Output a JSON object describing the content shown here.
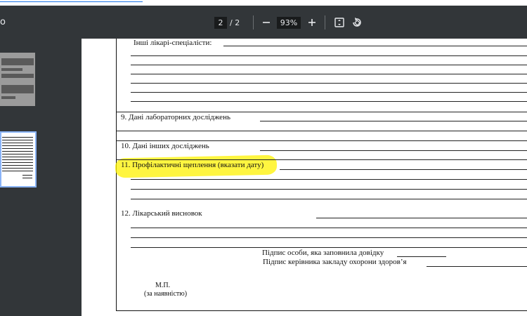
{
  "toolbar": {
    "title_fragment": "o",
    "current_page": "2",
    "page_separator": "/ 2",
    "zoom": "93%",
    "icons": [
      "zoom-out-icon",
      "zoom-in-icon",
      "fit-page-icon",
      "rotate-icon"
    ]
  },
  "document": {
    "other_specialists": "Інші лікарі-спеціалісти:",
    "section_9": "9. Дані лабораторних досліджень",
    "section_10": "10. Дані інших досліджень",
    "section_11": "11. Профілактичні  щеплення (вказати дату)",
    "section_12": "12. Лікарський висновок",
    "sign_filler": "Підпис особи, яка заповнила довідку",
    "sign_head": "Підпис керівника закладу охорони здоров’я",
    "stamp": "М.П.",
    "stamp_note": "(за наявністю)"
  },
  "colors": {
    "highlight": "#fff200",
    "toolbar_bg": "#323639",
    "viewer_bg": "#525659",
    "selected_thumb_border": "#8ab4f8"
  }
}
